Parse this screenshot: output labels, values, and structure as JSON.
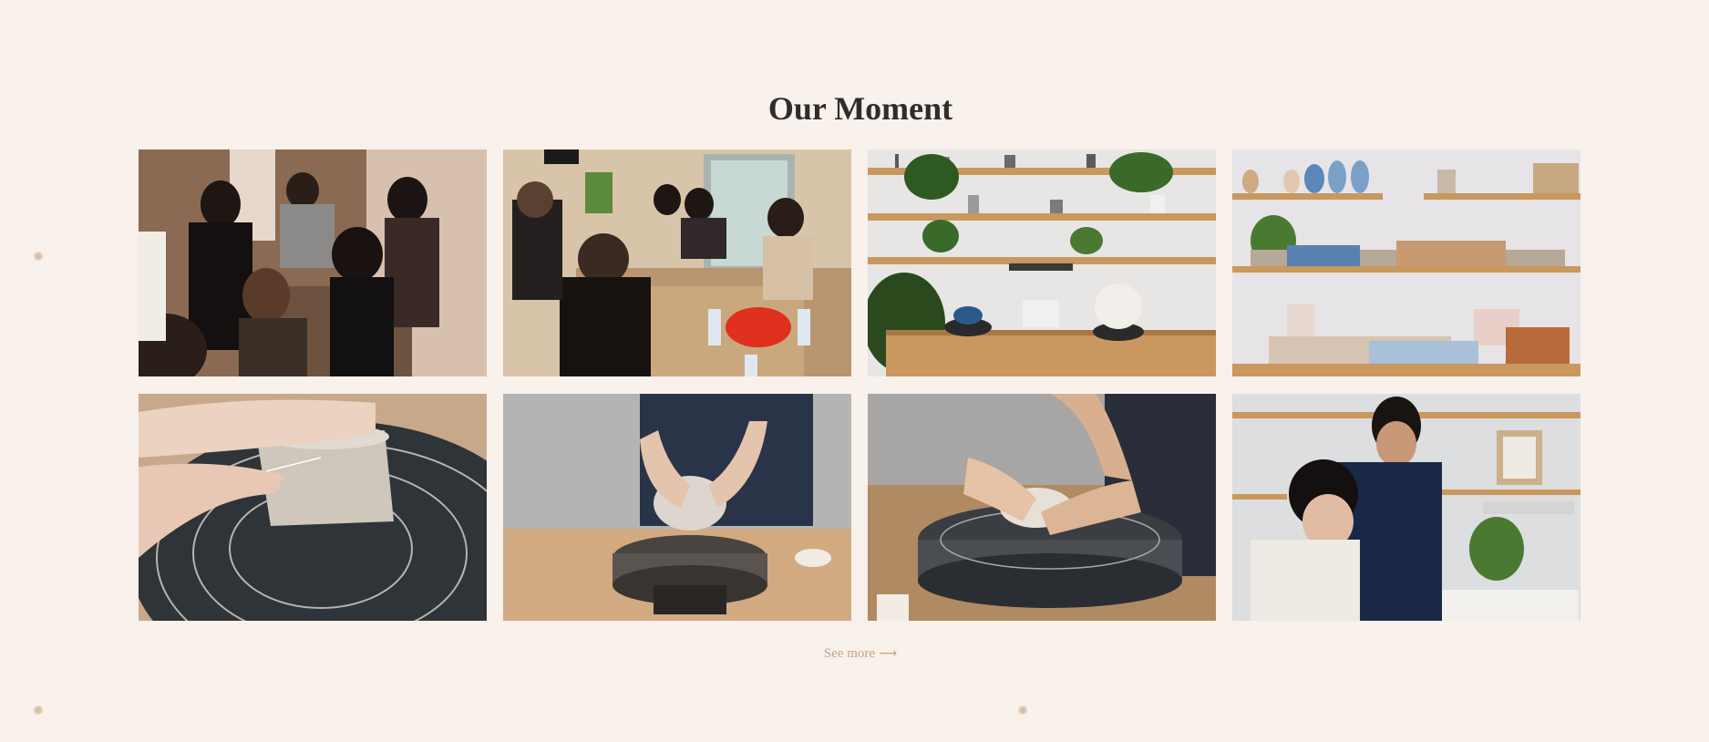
{
  "section": {
    "title": "Our Moment"
  },
  "gallery": {
    "photos": [
      {
        "subject": "workshop-group-table"
      },
      {
        "subject": "workshop-class-studio"
      },
      {
        "subject": "studio-shelves-plants"
      },
      {
        "subject": "ceramics-display-shelves"
      },
      {
        "subject": "hands-trimming-wheel"
      },
      {
        "subject": "hands-bowl-wheel"
      },
      {
        "subject": "hands-centering-clay"
      },
      {
        "subject": "couple-in-studio"
      }
    ]
  },
  "see_more": {
    "label": "See more",
    "arrow": "⟶"
  },
  "colors": {
    "background": "#f8f1ec",
    "title": "#2f2d2b",
    "link": "#c6a57c"
  }
}
